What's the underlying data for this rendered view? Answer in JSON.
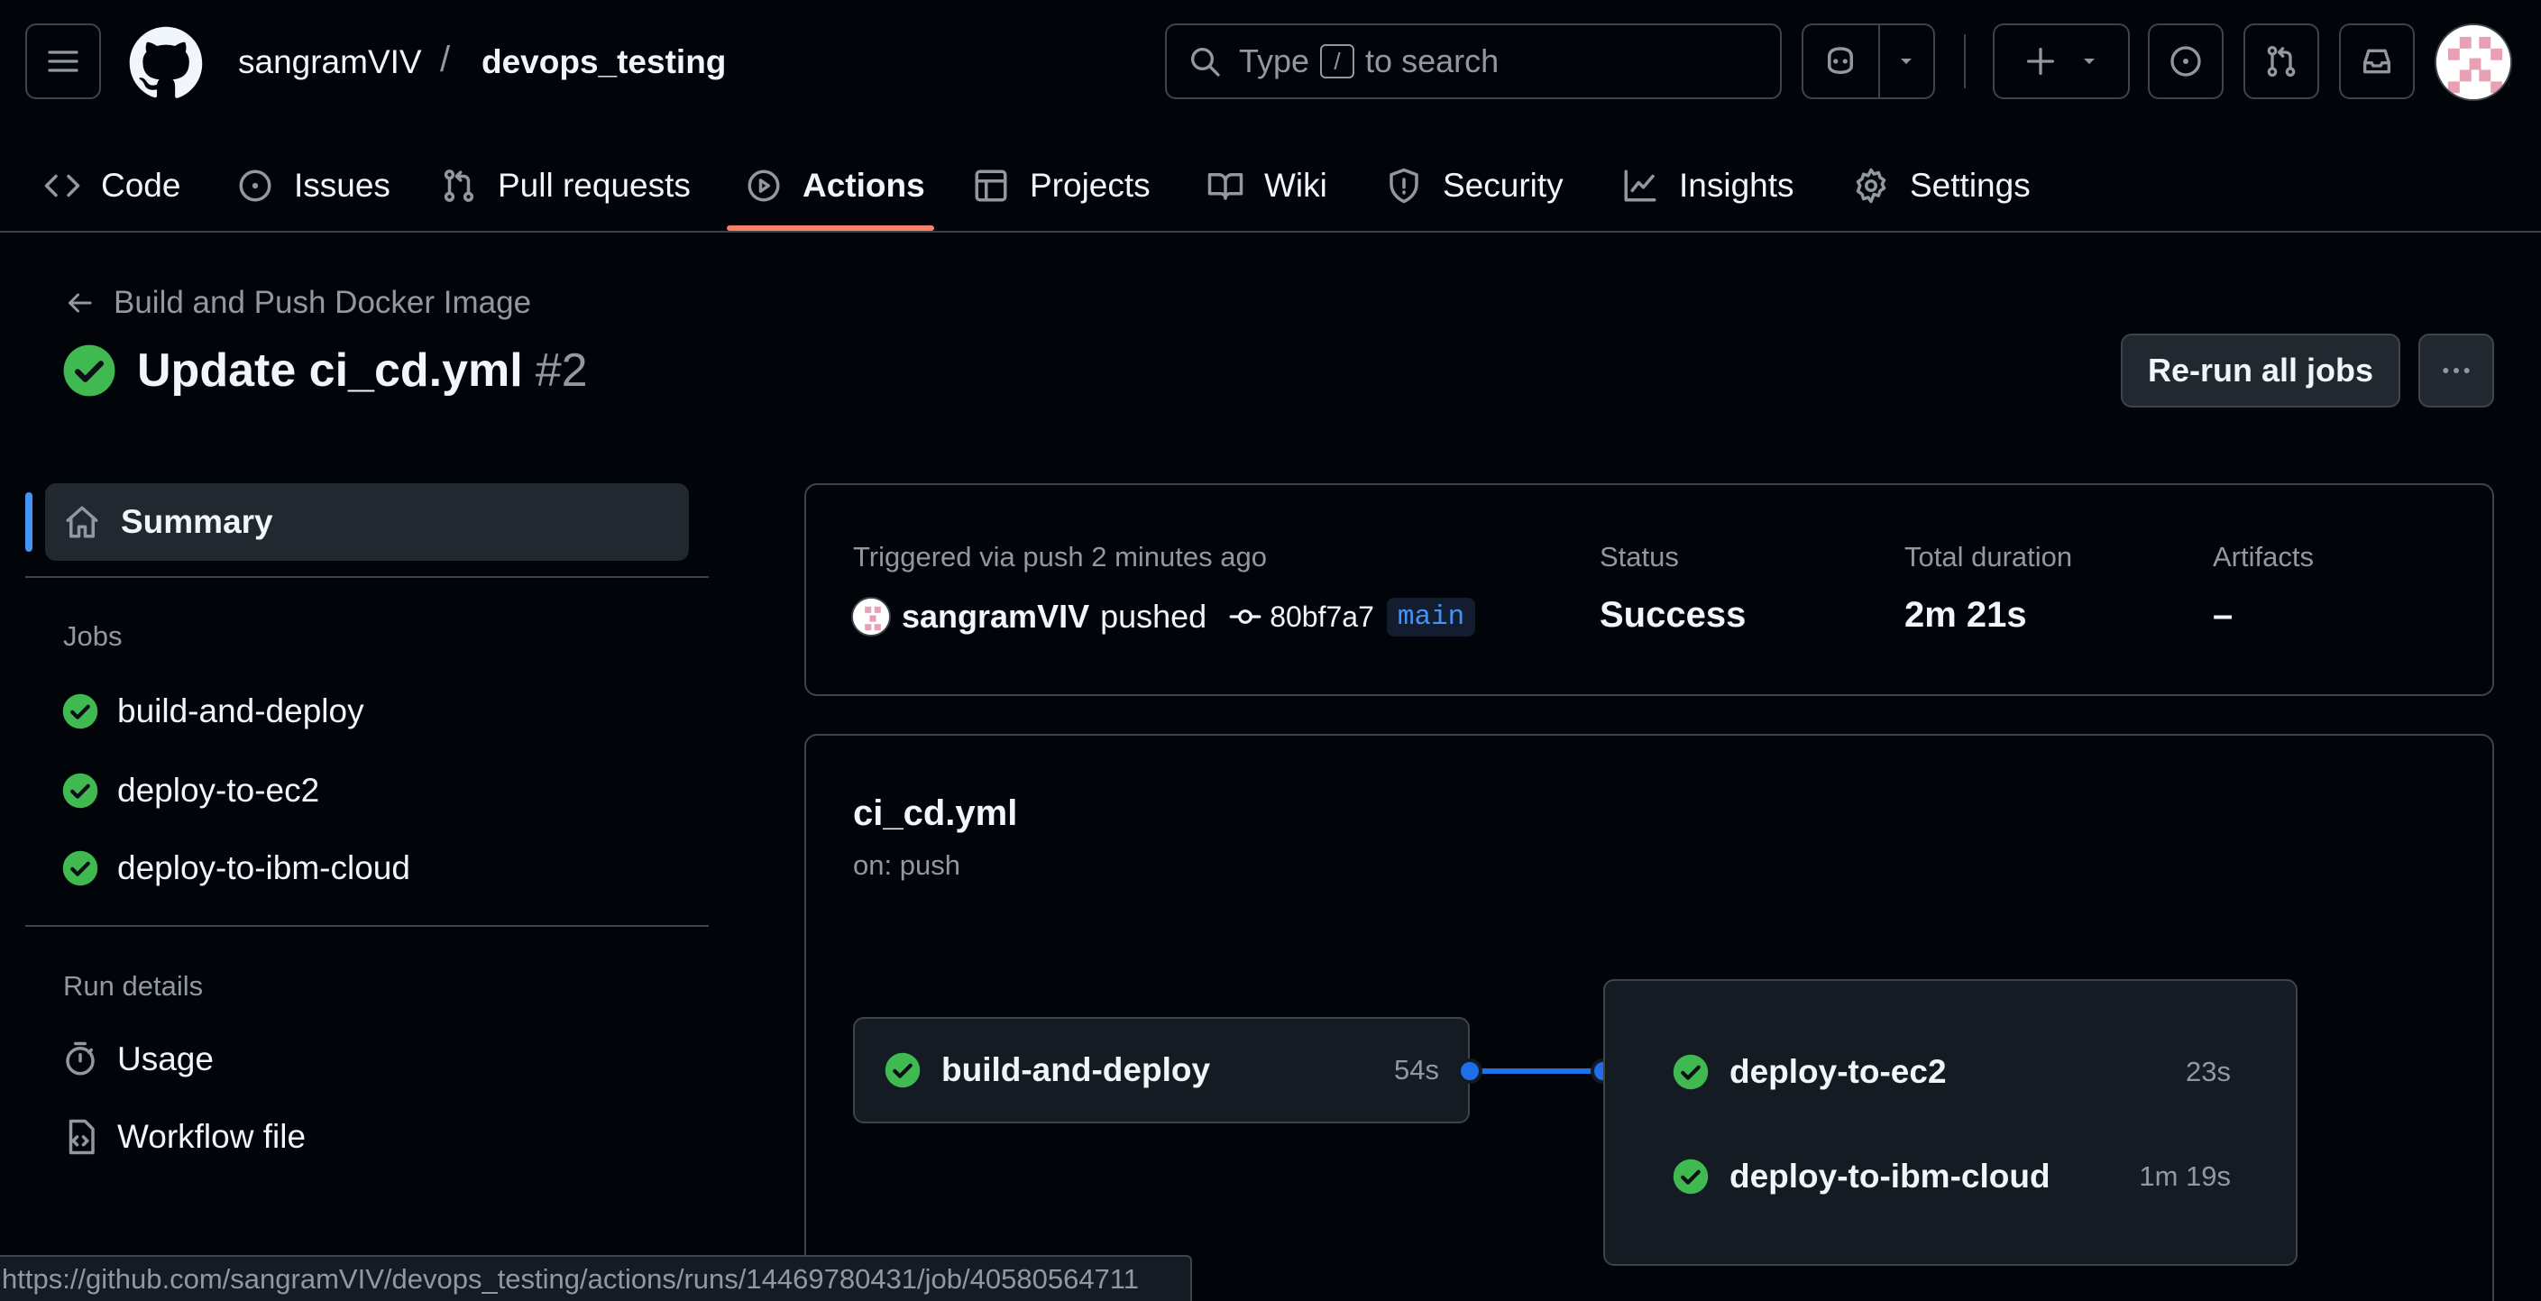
{
  "header": {
    "owner": "sangramVIV",
    "separator": "/",
    "repo": "devops_testing",
    "search": {
      "prefix": "Type",
      "key": "/",
      "suffix": "to search"
    }
  },
  "tabs": [
    {
      "label": "Code",
      "icon": "code-icon"
    },
    {
      "label": "Issues",
      "icon": "issue-icon"
    },
    {
      "label": "Pull requests",
      "icon": "pull-request-icon"
    },
    {
      "label": "Actions",
      "icon": "play-icon",
      "active": true
    },
    {
      "label": "Projects",
      "icon": "table-icon"
    },
    {
      "label": "Wiki",
      "icon": "book-icon"
    },
    {
      "label": "Security",
      "icon": "shield-icon"
    },
    {
      "label": "Insights",
      "icon": "graph-icon"
    },
    {
      "label": "Settings",
      "icon": "gear-icon"
    }
  ],
  "run": {
    "back_label": "Build and Push Docker Image",
    "title": "Update ci_cd.yml",
    "number": "#2",
    "rerun_label": "Re-run all jobs"
  },
  "sidebar": {
    "summary_label": "Summary",
    "jobs_heading": "Jobs",
    "jobs": [
      "build-and-deploy",
      "deploy-to-ec2",
      "deploy-to-ibm-cloud"
    ],
    "run_details_heading": "Run details",
    "usage_label": "Usage",
    "workflow_file_label": "Workflow file"
  },
  "summary": {
    "trigger_text": "Triggered via push 2 minutes ago",
    "actor": "sangramVIV",
    "action": "pushed",
    "commit": "80bf7a7",
    "branch": "main",
    "status_label": "Status",
    "status_value": "Success",
    "duration_label": "Total duration",
    "duration_value": "2m 21s",
    "artifacts_label": "Artifacts",
    "artifacts_value": "–"
  },
  "workflow": {
    "file": "ci_cd.yml",
    "trigger": "on: push",
    "jobs": [
      {
        "name": "build-and-deploy",
        "time": "54s"
      },
      {
        "name": "deploy-to-ec2",
        "time": "23s"
      },
      {
        "name": "deploy-to-ibm-cloud",
        "time": "1m 19s"
      }
    ]
  },
  "statusbar": {
    "url": "https://github.com/sangramVIV/devops_testing/actions/runs/14469780431/job/40580564711"
  },
  "colors": {
    "success": "#3fb950",
    "accent": "#4493f8",
    "tab_underline": "#f78166",
    "background": "#010409"
  }
}
